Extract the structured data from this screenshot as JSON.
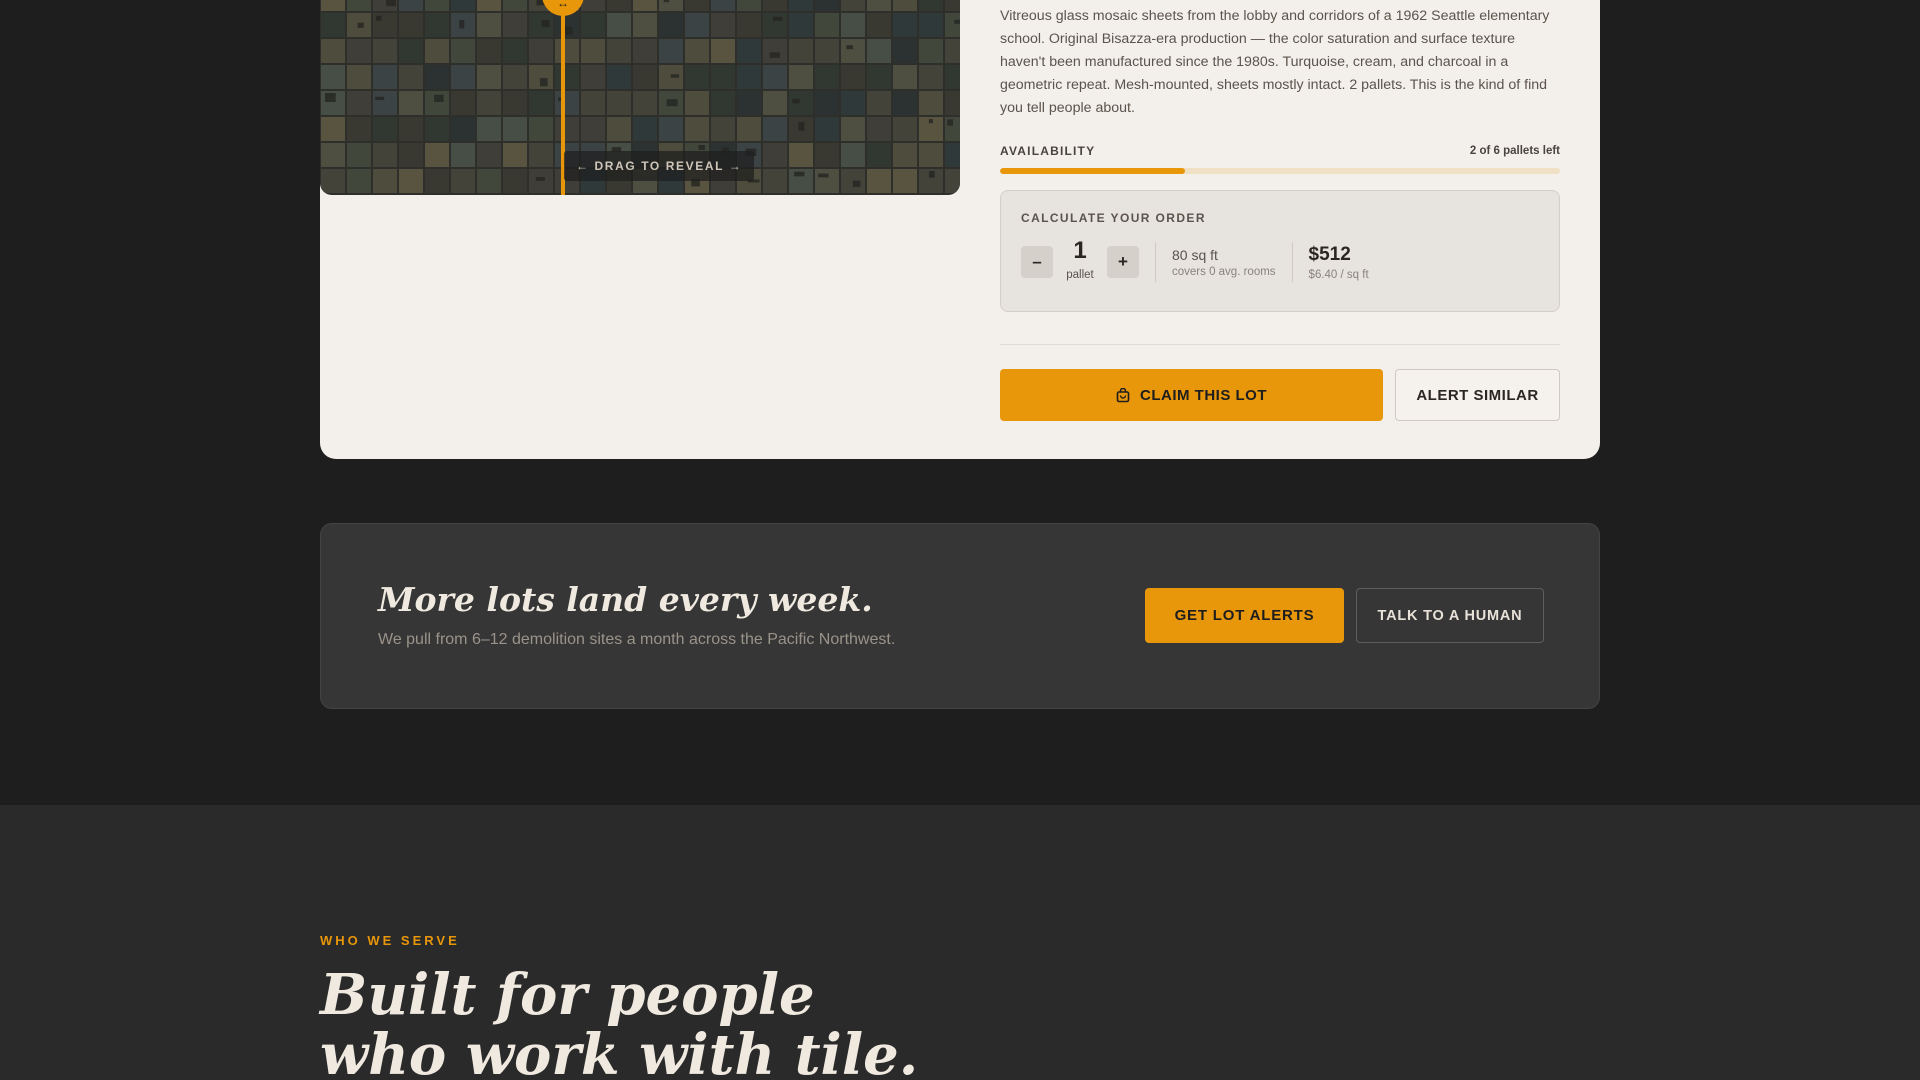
{
  "product": {
    "image_overlay": "← DRAG TO REVEAL →",
    "handle_glyph": "↔",
    "description": "Vitreous glass mosaic sheets from the lobby and corridors of a 1962 Seattle elementary school. Original Bisazza-era production — the color saturation and surface texture haven't been manufactured since the 1980s. Turquoise, cream, and charcoal in a geometric repeat. Mesh-mounted, sheets mostly intact. 2 pallets. This is the kind of find you tell people about.",
    "availability": {
      "label": "AVAILABILITY",
      "count_text": "2 of 6 pallets left",
      "remaining": 2,
      "total": 6,
      "fill_fraction": 0.33
    },
    "calculator": {
      "title": "CALCULATE YOUR ORDER",
      "decrement": "–",
      "increment": "+",
      "quantity": "1",
      "unit": "pallet",
      "coverage": "80 sq ft",
      "coverage_note": "covers 0 avg. rooms",
      "price": "$512",
      "price_note": "$6.40 / sq ft"
    },
    "actions": {
      "claim": "CLAIM THIS LOT",
      "claim_icon": "bag-icon",
      "alert": "ALERT SIMILAR"
    }
  },
  "cta": {
    "title": "More lots land every week.",
    "subtitle": "We pull from 6–12 demolition sites a month across the Pacific Northwest.",
    "primary": "GET LOT ALERTS",
    "secondary": "TALK TO A HUMAN"
  },
  "serve": {
    "eyebrow": "WHO WE SERVE",
    "title_line1": "Built for people",
    "title_line2": "who work with tile."
  },
  "colors": {
    "accent": "#e8960a",
    "page_bg": "#1e1e1e",
    "card_bg": "#f3efea",
    "banner_bg": "#363636",
    "section_bg": "#2a2a2a"
  }
}
